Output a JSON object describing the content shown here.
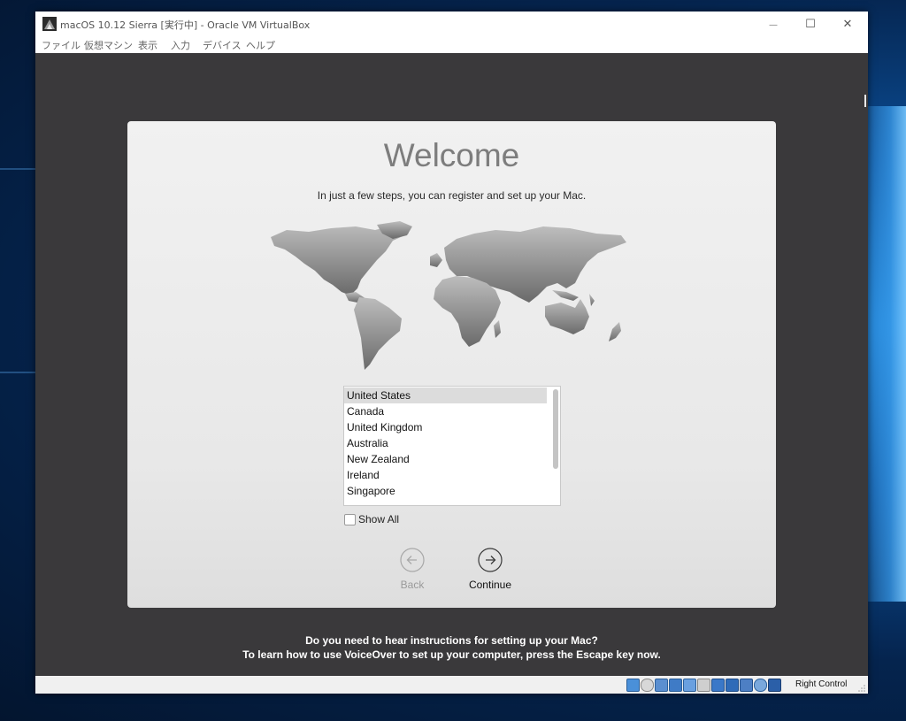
{
  "window": {
    "title": "macOS 10.12 Sierra [実行中] - Oracle VM VirtualBox",
    "controls": {
      "minimize": "—",
      "maximize": "☐",
      "close": "✕"
    }
  },
  "menu": {
    "items": [
      "ファイル",
      "仮想マシン",
      "表示",
      "入力",
      "デバイス",
      "ヘルプ"
    ]
  },
  "setup": {
    "title": "Welcome",
    "subtitle": "In just a few steps, you can register and set up your Mac.",
    "countries": [
      "United States",
      "Canada",
      "United Kingdom",
      "Australia",
      "New Zealand",
      "Ireland",
      "Singapore"
    ],
    "selected_country": "United States",
    "show_all_label": "Show All",
    "show_all_checked": false,
    "back_label": "Back",
    "continue_label": "Continue"
  },
  "voiceover": {
    "line1": "Do you need to hear instructions for setting up your Mac?",
    "line2": "To learn how to use VoiceOver to set up your computer, press the Escape key now."
  },
  "statusbar": {
    "host_key": "Right Control",
    "icons": [
      "hard-disk-icon",
      "optical-drive-icon",
      "audio-icon",
      "network-icon",
      "usb-icon",
      "shared-folder-icon",
      "display-icon",
      "video-capture-icon",
      "virtualization-icon",
      "mouse-integration-icon",
      "keyboard-capture-icon"
    ]
  },
  "colors": {
    "vm_background": "#3a393b",
    "panel": "#ebebeb",
    "title_gray": "#7d7d7d",
    "selection": "#dcdcdc"
  }
}
